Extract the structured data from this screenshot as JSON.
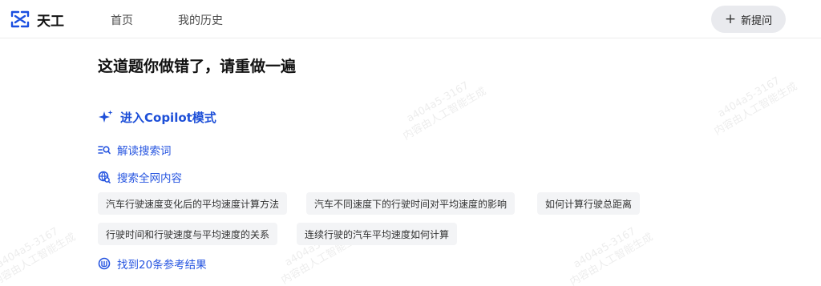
{
  "header": {
    "logo_text": "天工",
    "nav": [
      "首页",
      "我的历史"
    ],
    "new_button": "新提问"
  },
  "main": {
    "title": "这道题你做错了，请重做一遍",
    "copilot_label": "进入Copilot模式",
    "steps": [
      "解读搜索词",
      "搜索全网内容",
      "找到20条参考结果"
    ],
    "chips": [
      "汽车行驶速度变化后的平均速度计算方法",
      "汽车不同速度下的行驶时间对平均速度的影响",
      "如何计算行驶总距离",
      "行驶时间和行驶速度与平均速度的关系",
      "连续行驶的汽车平均速度如何计算"
    ]
  },
  "watermark": {
    "line1": "a404a5-3167",
    "line2": "内容由人工智能生成"
  },
  "colors": {
    "accent": "#2554e0",
    "logo_blue": "#1a4fe0",
    "chip_bg": "#f3f4f6",
    "button_bg": "#e9eaee"
  },
  "icons": [
    "logo-icon",
    "plus-icon",
    "sparkle-icon",
    "search-list-icon",
    "web-search-icon",
    "result-icon"
  ]
}
